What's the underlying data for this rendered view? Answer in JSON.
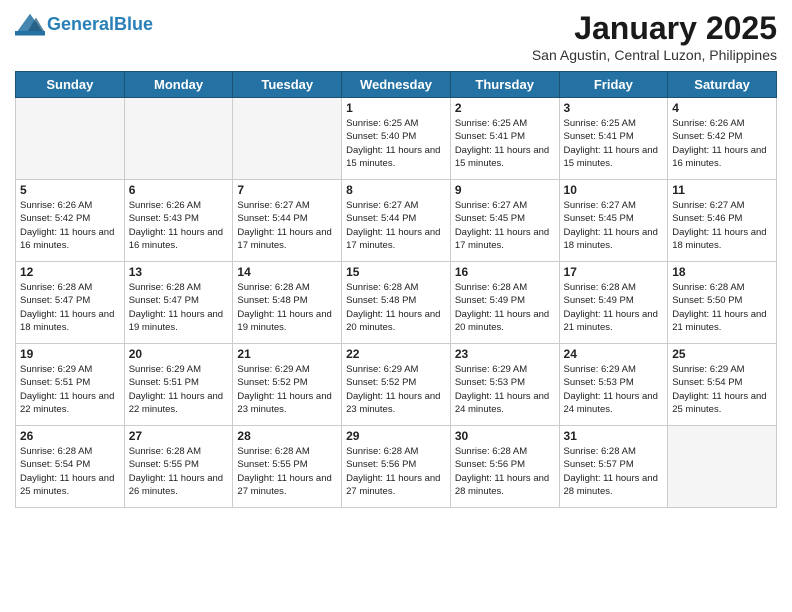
{
  "header": {
    "logo_line1": "General",
    "logo_line2": "Blue",
    "month_title": "January 2025",
    "subtitle": "San Agustin, Central Luzon, Philippines"
  },
  "days_of_week": [
    "Sunday",
    "Monday",
    "Tuesday",
    "Wednesday",
    "Thursday",
    "Friday",
    "Saturday"
  ],
  "weeks": [
    [
      {
        "day": "",
        "sunrise": "",
        "sunset": "",
        "daylight": "",
        "empty": true
      },
      {
        "day": "",
        "sunrise": "",
        "sunset": "",
        "daylight": "",
        "empty": true
      },
      {
        "day": "",
        "sunrise": "",
        "sunset": "",
        "daylight": "",
        "empty": true
      },
      {
        "day": "1",
        "sunrise": "Sunrise: 6:25 AM",
        "sunset": "Sunset: 5:40 PM",
        "daylight": "Daylight: 11 hours and 15 minutes."
      },
      {
        "day": "2",
        "sunrise": "Sunrise: 6:25 AM",
        "sunset": "Sunset: 5:41 PM",
        "daylight": "Daylight: 11 hours and 15 minutes."
      },
      {
        "day": "3",
        "sunrise": "Sunrise: 6:25 AM",
        "sunset": "Sunset: 5:41 PM",
        "daylight": "Daylight: 11 hours and 15 minutes."
      },
      {
        "day": "4",
        "sunrise": "Sunrise: 6:26 AM",
        "sunset": "Sunset: 5:42 PM",
        "daylight": "Daylight: 11 hours and 16 minutes."
      }
    ],
    [
      {
        "day": "5",
        "sunrise": "Sunrise: 6:26 AM",
        "sunset": "Sunset: 5:42 PM",
        "daylight": "Daylight: 11 hours and 16 minutes."
      },
      {
        "day": "6",
        "sunrise": "Sunrise: 6:26 AM",
        "sunset": "Sunset: 5:43 PM",
        "daylight": "Daylight: 11 hours and 16 minutes."
      },
      {
        "day": "7",
        "sunrise": "Sunrise: 6:27 AM",
        "sunset": "Sunset: 5:44 PM",
        "daylight": "Daylight: 11 hours and 17 minutes."
      },
      {
        "day": "8",
        "sunrise": "Sunrise: 6:27 AM",
        "sunset": "Sunset: 5:44 PM",
        "daylight": "Daylight: 11 hours and 17 minutes."
      },
      {
        "day": "9",
        "sunrise": "Sunrise: 6:27 AM",
        "sunset": "Sunset: 5:45 PM",
        "daylight": "Daylight: 11 hours and 17 minutes."
      },
      {
        "day": "10",
        "sunrise": "Sunrise: 6:27 AM",
        "sunset": "Sunset: 5:45 PM",
        "daylight": "Daylight: 11 hours and 18 minutes."
      },
      {
        "day": "11",
        "sunrise": "Sunrise: 6:27 AM",
        "sunset": "Sunset: 5:46 PM",
        "daylight": "Daylight: 11 hours and 18 minutes."
      }
    ],
    [
      {
        "day": "12",
        "sunrise": "Sunrise: 6:28 AM",
        "sunset": "Sunset: 5:47 PM",
        "daylight": "Daylight: 11 hours and 18 minutes."
      },
      {
        "day": "13",
        "sunrise": "Sunrise: 6:28 AM",
        "sunset": "Sunset: 5:47 PM",
        "daylight": "Daylight: 11 hours and 19 minutes."
      },
      {
        "day": "14",
        "sunrise": "Sunrise: 6:28 AM",
        "sunset": "Sunset: 5:48 PM",
        "daylight": "Daylight: 11 hours and 19 minutes."
      },
      {
        "day": "15",
        "sunrise": "Sunrise: 6:28 AM",
        "sunset": "Sunset: 5:48 PM",
        "daylight": "Daylight: 11 hours and 20 minutes."
      },
      {
        "day": "16",
        "sunrise": "Sunrise: 6:28 AM",
        "sunset": "Sunset: 5:49 PM",
        "daylight": "Daylight: 11 hours and 20 minutes."
      },
      {
        "day": "17",
        "sunrise": "Sunrise: 6:28 AM",
        "sunset": "Sunset: 5:49 PM",
        "daylight": "Daylight: 11 hours and 21 minutes."
      },
      {
        "day": "18",
        "sunrise": "Sunrise: 6:28 AM",
        "sunset": "Sunset: 5:50 PM",
        "daylight": "Daylight: 11 hours and 21 minutes."
      }
    ],
    [
      {
        "day": "19",
        "sunrise": "Sunrise: 6:29 AM",
        "sunset": "Sunset: 5:51 PM",
        "daylight": "Daylight: 11 hours and 22 minutes."
      },
      {
        "day": "20",
        "sunrise": "Sunrise: 6:29 AM",
        "sunset": "Sunset: 5:51 PM",
        "daylight": "Daylight: 11 hours and 22 minutes."
      },
      {
        "day": "21",
        "sunrise": "Sunrise: 6:29 AM",
        "sunset": "Sunset: 5:52 PM",
        "daylight": "Daylight: 11 hours and 23 minutes."
      },
      {
        "day": "22",
        "sunrise": "Sunrise: 6:29 AM",
        "sunset": "Sunset: 5:52 PM",
        "daylight": "Daylight: 11 hours and 23 minutes."
      },
      {
        "day": "23",
        "sunrise": "Sunrise: 6:29 AM",
        "sunset": "Sunset: 5:53 PM",
        "daylight": "Daylight: 11 hours and 24 minutes."
      },
      {
        "day": "24",
        "sunrise": "Sunrise: 6:29 AM",
        "sunset": "Sunset: 5:53 PM",
        "daylight": "Daylight: 11 hours and 24 minutes."
      },
      {
        "day": "25",
        "sunrise": "Sunrise: 6:29 AM",
        "sunset": "Sunset: 5:54 PM",
        "daylight": "Daylight: 11 hours and 25 minutes."
      }
    ],
    [
      {
        "day": "26",
        "sunrise": "Sunrise: 6:28 AM",
        "sunset": "Sunset: 5:54 PM",
        "daylight": "Daylight: 11 hours and 25 minutes."
      },
      {
        "day": "27",
        "sunrise": "Sunrise: 6:28 AM",
        "sunset": "Sunset: 5:55 PM",
        "daylight": "Daylight: 11 hours and 26 minutes."
      },
      {
        "day": "28",
        "sunrise": "Sunrise: 6:28 AM",
        "sunset": "Sunset: 5:55 PM",
        "daylight": "Daylight: 11 hours and 27 minutes."
      },
      {
        "day": "29",
        "sunrise": "Sunrise: 6:28 AM",
        "sunset": "Sunset: 5:56 PM",
        "daylight": "Daylight: 11 hours and 27 minutes."
      },
      {
        "day": "30",
        "sunrise": "Sunrise: 6:28 AM",
        "sunset": "Sunset: 5:56 PM",
        "daylight": "Daylight: 11 hours and 28 minutes."
      },
      {
        "day": "31",
        "sunrise": "Sunrise: 6:28 AM",
        "sunset": "Sunset: 5:57 PM",
        "daylight": "Daylight: 11 hours and 28 minutes."
      },
      {
        "day": "",
        "sunrise": "",
        "sunset": "",
        "daylight": "",
        "empty": true
      }
    ]
  ]
}
